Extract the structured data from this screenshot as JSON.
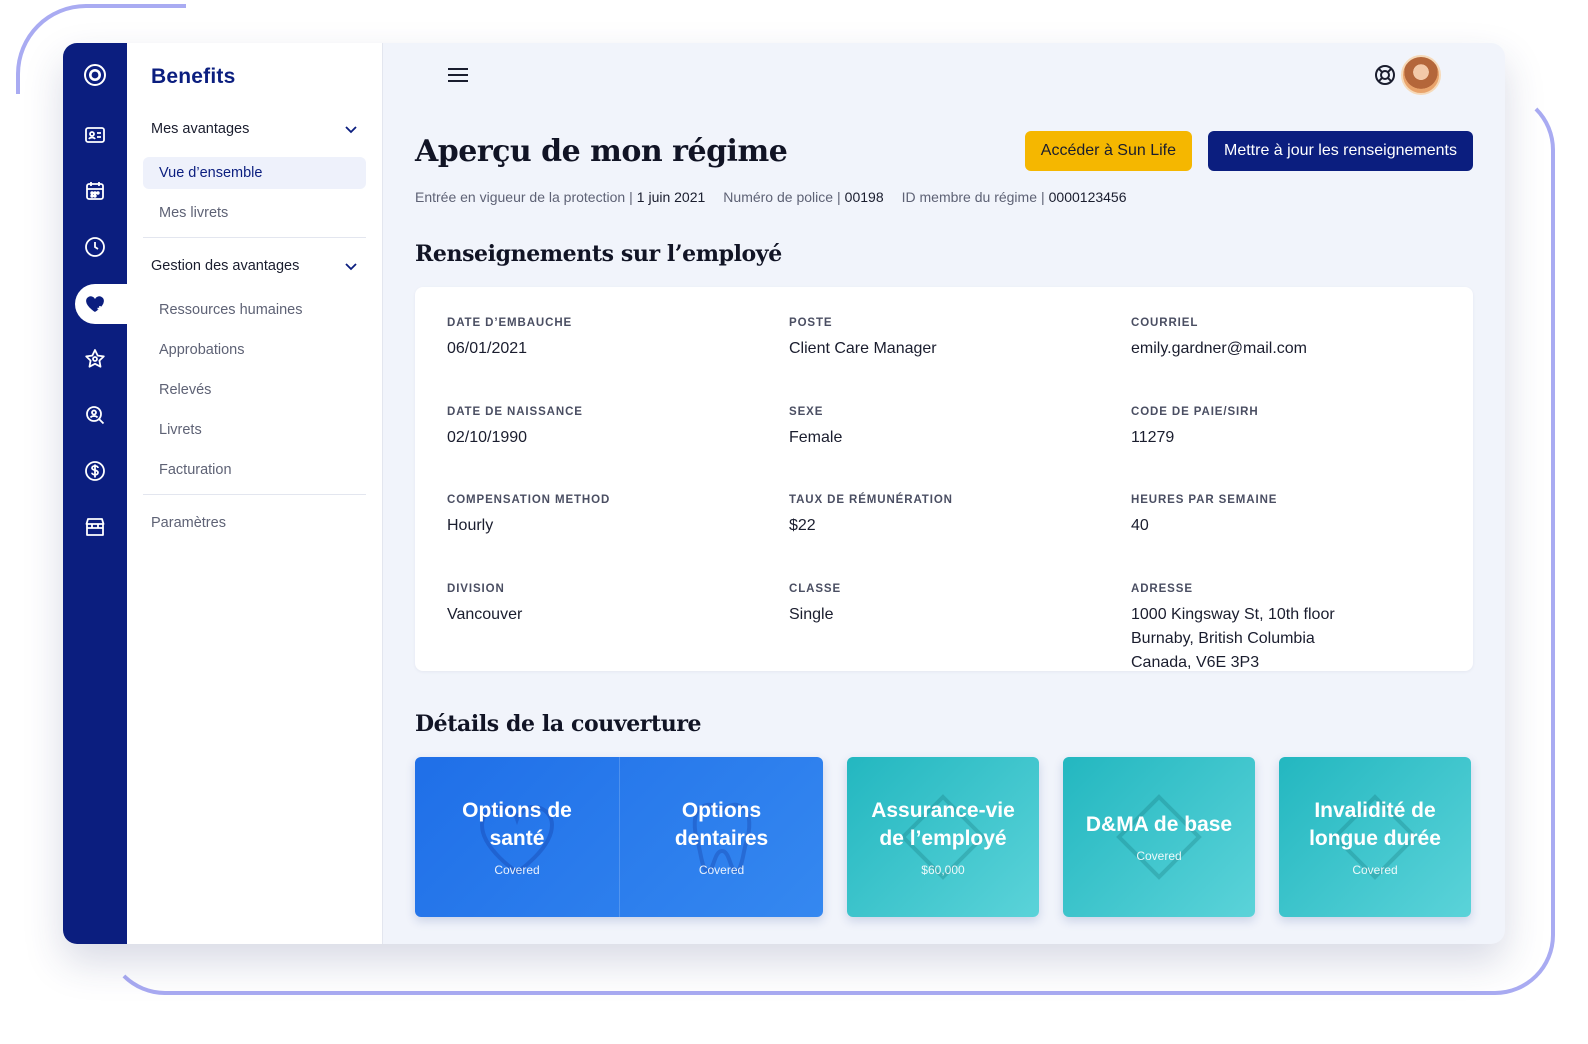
{
  "app": {
    "brand": "Benefits"
  },
  "sidebar": {
    "groups": [
      {
        "label": "Mes avantages",
        "items": [
          {
            "label": "Vue d’ensemble",
            "active": true
          },
          {
            "label": "Mes livrets"
          }
        ]
      },
      {
        "label": "Gestion des avantages",
        "items": [
          {
            "label": "Ressources humaines"
          },
          {
            "label": "Approbations"
          },
          {
            "label": "Relevés"
          },
          {
            "label": "Livrets"
          },
          {
            "label": "Facturation"
          }
        ]
      }
    ],
    "settings": "Paramètres"
  },
  "rail_icons": [
    "logo-icon",
    "id-card-icon",
    "calendar-icon",
    "clock-icon",
    "heart-icon",
    "star-icon",
    "search-person-icon",
    "dollar-icon",
    "store-icon"
  ],
  "header": {
    "title": "Aperçu de mon régime",
    "btn_sunlife": "Accéder à Sun Life",
    "btn_update": "Mettre à jour les renseignements"
  },
  "meta": {
    "coverage_label": "Entrée en vigueur de la protection",
    "coverage_value": "1 juin 2021",
    "policy_label": "Numéro de police",
    "policy_value": "00198",
    "member_label": "ID membre du régime",
    "member_value": "0000123456",
    "sep": "|"
  },
  "employee": {
    "section_title": "Renseignements sur l’employé",
    "fields": [
      {
        "label": "Date d’embauche",
        "value": "06/01/2021"
      },
      {
        "label": "Poste",
        "value": "Client Care Manager"
      },
      {
        "label": "Courriel",
        "value": "emily.gardner@mail.com"
      },
      {
        "label": "Date de naissance",
        "value": "02/10/1990"
      },
      {
        "label": "Sexe",
        "value": "Female"
      },
      {
        "label": "Code de paie/SIRH",
        "value": "11279"
      },
      {
        "label": "Compensation method",
        "value": "Hourly"
      },
      {
        "label": "Taux de rémunération",
        "value": "$22"
      },
      {
        "label": "Heures par semaine",
        "value": "40"
      },
      {
        "label": "Division",
        "value": "Vancouver"
      },
      {
        "label": "Classe",
        "value": "Single"
      },
      {
        "label": "Adresse",
        "value_lines": [
          "1000 Kingsway St, 10th floor",
          "Burnaby, British Columbia",
          "Canada, V6E 3P3"
        ]
      }
    ]
  },
  "coverage": {
    "section_title": "Détails de la couverture",
    "tiles": [
      {
        "name_lines": [
          "Options de",
          "santé"
        ],
        "sub": "Covered"
      },
      {
        "name_lines": [
          "Options",
          "dentaires"
        ],
        "sub": "Covered"
      },
      {
        "name_lines": [
          "Assurance-vie",
          "de l’employé"
        ],
        "sub": "$60,000"
      },
      {
        "name_lines": [
          "D&MA de base"
        ],
        "sub": "Covered"
      },
      {
        "name_lines": [
          "Invalidité de",
          "longue durée"
        ],
        "sub": "Covered"
      }
    ]
  },
  "colors": {
    "navy": "#0b1e7f",
    "yellow": "#f5b700",
    "blue_tile": "#1f6fe8",
    "teal_tile": "#23b7c0"
  }
}
